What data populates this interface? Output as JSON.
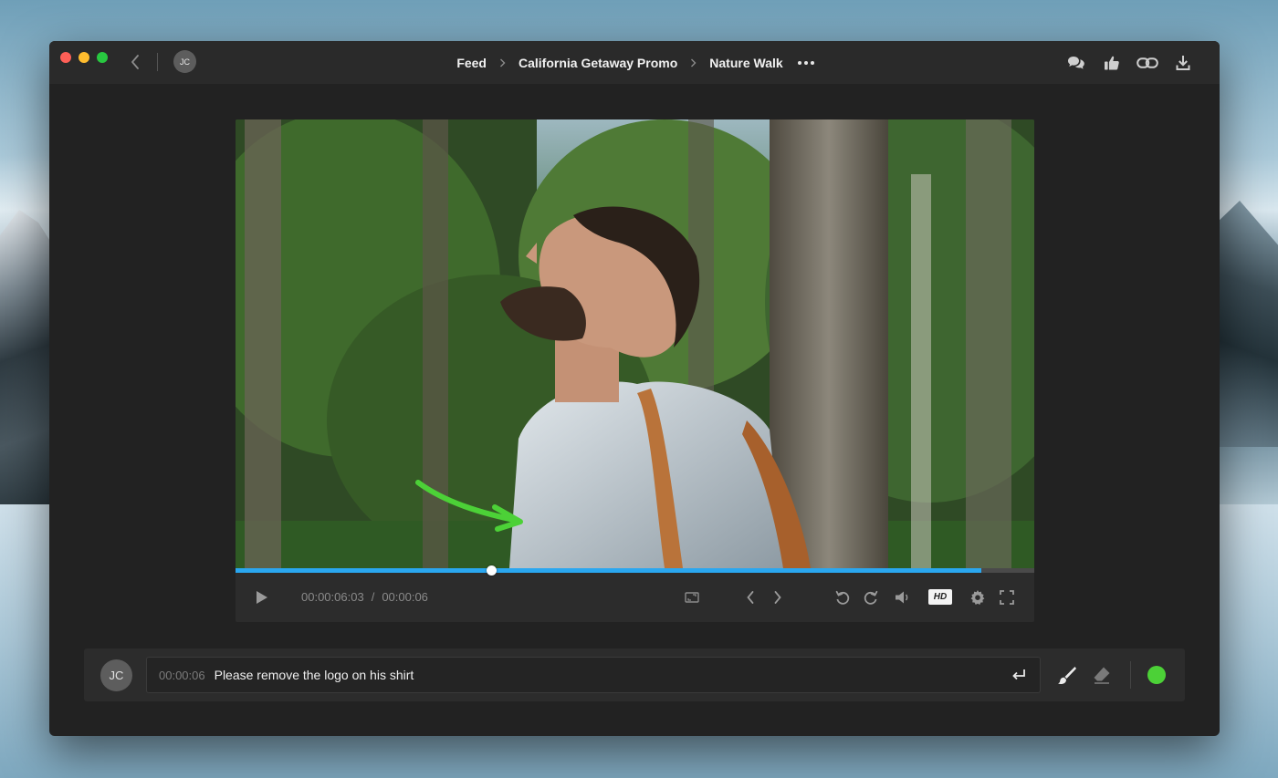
{
  "window": {
    "avatar_initials": "JC",
    "breadcrumbs": [
      "Feed",
      "California Getaway Promo",
      "Nature Walk"
    ],
    "actions": [
      "comments-icon",
      "thumbs-up-icon",
      "link-icon",
      "download-icon"
    ]
  },
  "player": {
    "current_time": "00:00:06:03",
    "time_separator": "/",
    "duration": "00:00:06",
    "quality_badge": "HD",
    "playhead_fraction": 0.32,
    "loaded_fraction": 0.934
  },
  "comment": {
    "avatar_initials": "JC",
    "timestamp": "00:00:06",
    "text": "Please remove the logo on his shirt",
    "active_color": "#4cd137"
  },
  "colors": {
    "accent": "#2aa7f0",
    "annotation": "#4cd137",
    "window_bg": "#222222"
  }
}
